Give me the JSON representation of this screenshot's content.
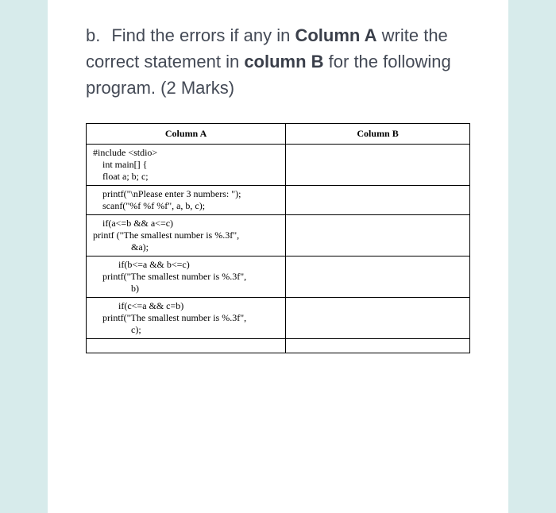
{
  "question": {
    "letter": "b.",
    "part1": "Find the errors if any in ",
    "bold1": "Column A",
    "part2": " write the correct statement in ",
    "bold2": "column B",
    "part3": " for the following program.   (2 Marks)"
  },
  "table": {
    "headerA": "Column A",
    "headerB": "Column B",
    "rows": [
      {
        "lines": [
          {
            "text": "#include <stdio>",
            "cls": ""
          },
          {
            "text": "int main[] {",
            "cls": "ind1"
          },
          {
            "text": "float a; b; c;",
            "cls": "ind1"
          }
        ],
        "colB": ""
      },
      {
        "lines": [
          {
            "text": "printf(\"\\nPlease enter 3 numbers: \");",
            "cls": "ind1"
          },
          {
            "text": "scanf(\"%f %f %f\", a, b, c);",
            "cls": "ind1"
          }
        ],
        "colB": ""
      },
      {
        "lines": [
          {
            "text": "if(a<=b && a<=c)",
            "cls": "ind1"
          },
          {
            "text": "printf (\"The smallest number is %.3f\",",
            "cls": ""
          },
          {
            "text": "&a);",
            "cls": "ind-center"
          }
        ],
        "colB": ""
      },
      {
        "lines": [
          {
            "text": "if(b<=a && b<=c)",
            "cls": "ind2"
          },
          {
            "text": "printf(\"The smallest number is %.3f\",",
            "cls": "ind1"
          },
          {
            "text": "b)",
            "cls": "ind-center"
          }
        ],
        "colB": ""
      },
      {
        "lines": [
          {
            "text": "if(c<=a && c=b)",
            "cls": "ind2"
          },
          {
            "text": "printf(\"The smallest number is %.3f\",",
            "cls": "ind1"
          },
          {
            "text": "c);",
            "cls": "ind-center"
          }
        ],
        "colB": ""
      },
      {
        "lines": [
          {
            "text": "",
            "cls": ""
          }
        ],
        "colB": ""
      }
    ]
  }
}
